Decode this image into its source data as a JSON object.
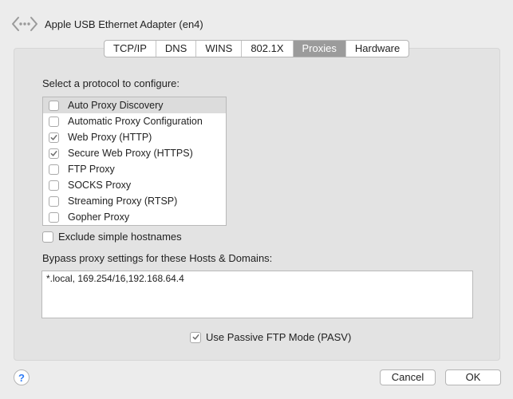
{
  "header": {
    "title": "Apple USB Ethernet Adapter (en4)",
    "icon": "network-adapter-icon"
  },
  "tabs": [
    {
      "label": "TCP/IP",
      "active": false
    },
    {
      "label": "DNS",
      "active": false
    },
    {
      "label": "WINS",
      "active": false
    },
    {
      "label": "802.1X",
      "active": false
    },
    {
      "label": "Proxies",
      "active": true
    },
    {
      "label": "Hardware",
      "active": false
    }
  ],
  "protocols": {
    "label": "Select a protocol to configure:",
    "items": [
      {
        "label": "Auto Proxy Discovery",
        "checked": false,
        "selected": true
      },
      {
        "label": "Automatic Proxy Configuration",
        "checked": false,
        "selected": false
      },
      {
        "label": "Web Proxy (HTTP)",
        "checked": true,
        "selected": false
      },
      {
        "label": "Secure Web Proxy (HTTPS)",
        "checked": true,
        "selected": false
      },
      {
        "label": "FTP Proxy",
        "checked": false,
        "selected": false
      },
      {
        "label": "SOCKS Proxy",
        "checked": false,
        "selected": false
      },
      {
        "label": "Streaming Proxy (RTSP)",
        "checked": false,
        "selected": false
      },
      {
        "label": "Gopher Proxy",
        "checked": false,
        "selected": false
      }
    ]
  },
  "exclude": {
    "label": "Exclude simple hostnames",
    "checked": false
  },
  "bypass": {
    "label": "Bypass proxy settings for these Hosts & Domains:",
    "value": "*.local, 169.254/16,192.168.64.4"
  },
  "pasv": {
    "label": "Use Passive FTP Mode (PASV)",
    "checked": true
  },
  "footer": {
    "help_label": "?",
    "cancel_label": "Cancel",
    "ok_label": "OK"
  },
  "colors": {
    "active_tab": "#9b9b9b",
    "checkmark": "#6e6e6e",
    "help": "#2f7cf6"
  }
}
